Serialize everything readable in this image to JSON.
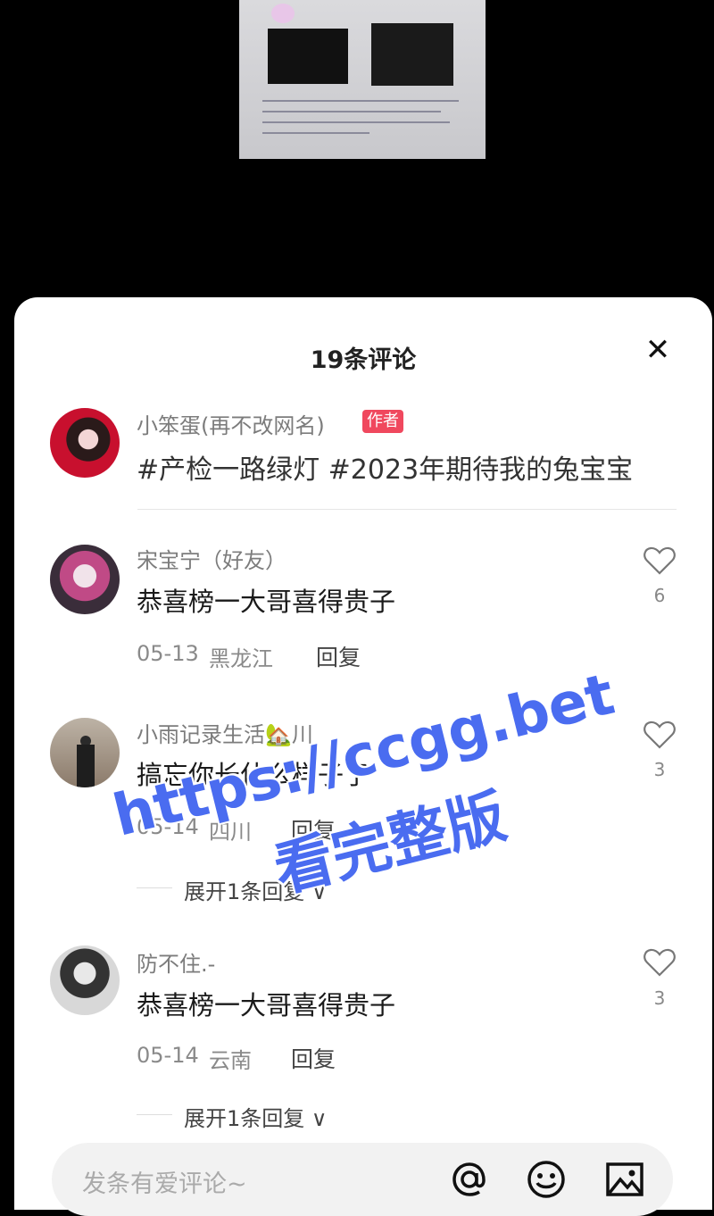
{
  "header": {
    "title": "19条评论",
    "close_label": "✕"
  },
  "author_post": {
    "username": "小笨蛋(再不改网名)",
    "badge": "作者",
    "text": "#产检一路绿灯 #2023年期待我的兔宝宝"
  },
  "comments": [
    {
      "username": "宋宝宁（好友）",
      "text": "恭喜榜一大哥喜得贵子",
      "date": "05-13",
      "location": "黑龙江",
      "reply_label": "回复",
      "likes": "6"
    },
    {
      "username": "小雨记录生活🏡川",
      "text": "搞忘你长什么样子了",
      "date": "05-14",
      "location": "四川",
      "reply_label": "回复",
      "likes": "3",
      "expand_label": "展开1条回复 ∨"
    },
    {
      "username": "防不住.-",
      "text": "恭喜榜一大哥喜得贵子",
      "date": "05-14",
      "location": "云南",
      "reply_label": "回复",
      "likes": "3",
      "expand_label": "展开1条回复 ∨"
    }
  ],
  "input": {
    "placeholder": "发条有爱评论~"
  },
  "icons": {
    "close": "close-icon",
    "like": "heart-outline-icon",
    "mention": "at-icon",
    "emoji": "smiley-icon",
    "image": "image-icon"
  },
  "watermark": {
    "line1": "https://ccgg.bet",
    "line2": "看完整版"
  },
  "colors": {
    "badge": "#f0485e",
    "watermark": "#4a6cf0"
  }
}
